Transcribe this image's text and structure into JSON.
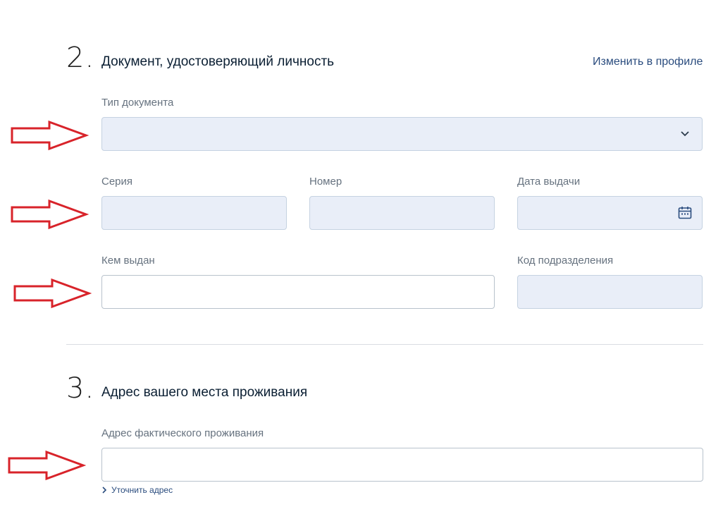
{
  "section2": {
    "number": "2.",
    "title": "Документ, удостоверяющий личность",
    "edit_link": "Изменить в профиле",
    "doc_type_label": "Тип документа",
    "series_label": "Серия",
    "number_label": "Номер",
    "issue_date_label": "Дата выдачи",
    "issued_by_label": "Кем выдан",
    "division_code_label": "Код подразделения"
  },
  "section3": {
    "number": "3.",
    "title": "Адрес вашего места проживания",
    "address_label": "Адрес фактического проживания",
    "clarify_link": "Уточнить адрес"
  },
  "colors": {
    "annotation_arrow": "#d8232a",
    "field_fill": "#e9eef8",
    "link": "#2a4c7e"
  },
  "icons": [
    "chevron-down-icon",
    "calendar-icon",
    "chevron-right-icon",
    "red-arrow-annotation"
  ]
}
